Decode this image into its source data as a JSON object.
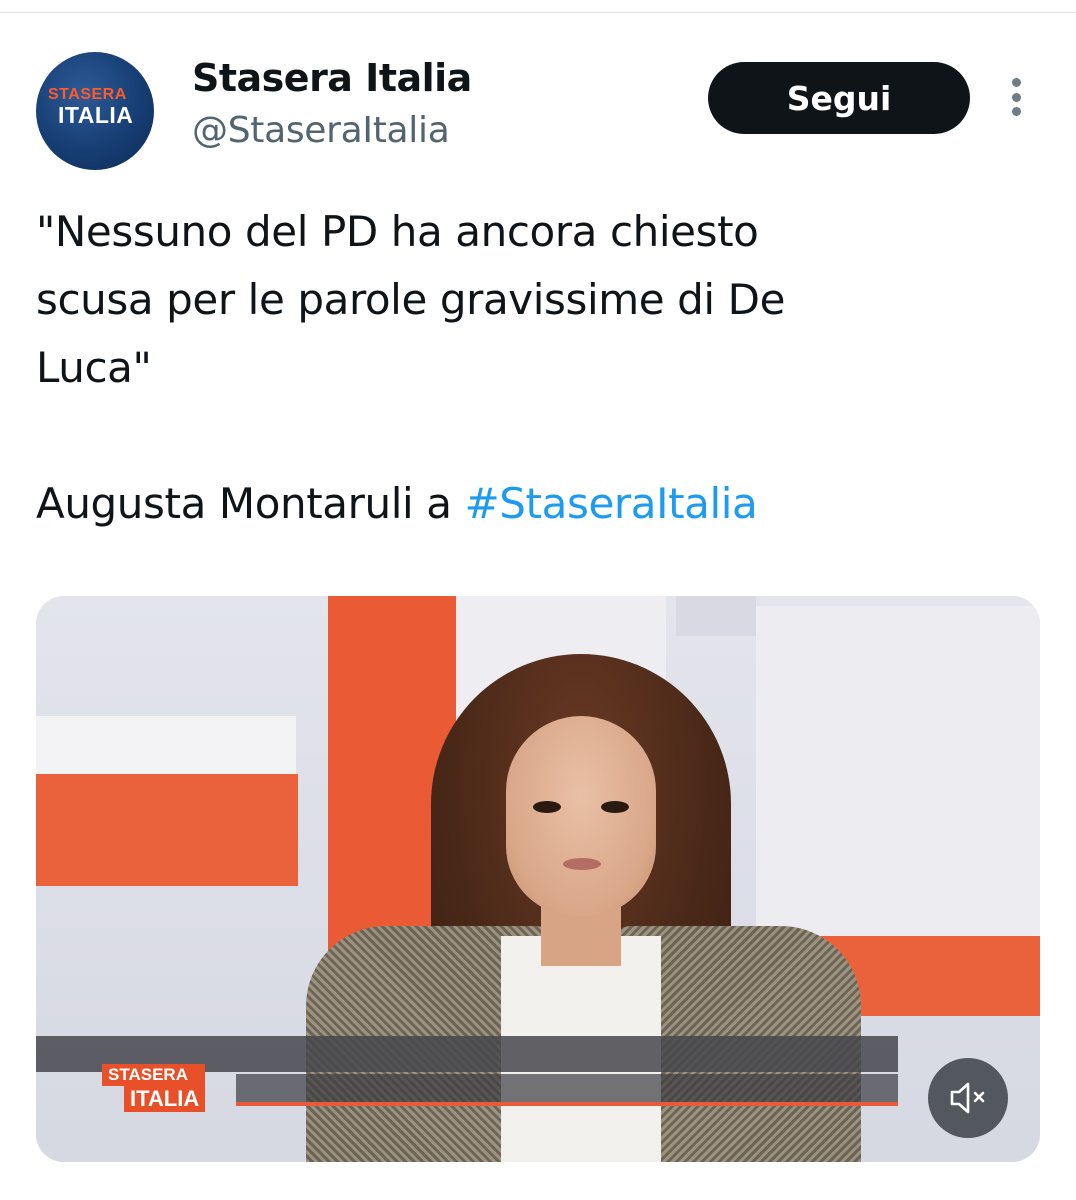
{
  "account": {
    "avatar_logo_top": "STASERA",
    "avatar_logo_bottom": "ITALIA",
    "display_name": "Stasera Italia",
    "handle": "@StaseraItalia",
    "follow_label": "Segui"
  },
  "tweet": {
    "lines": [
      "\"Nessuno del PD ha ancora chiesto",
      "scusa per le parole gravissime di De",
      "Luca\""
    ],
    "credit_prefix": "Augusta Montaruli a ",
    "hashtag": "#StaseraItalia"
  },
  "media": {
    "overlay_logo_top": "STASERA",
    "overlay_logo_bottom": "ITALIA",
    "mute_icon": "speaker-muted-icon"
  },
  "colors": {
    "follow_button_bg": "#0f1419",
    "hashtag": "#1d9bf0",
    "handle": "#536471",
    "brand_orange": "#e8502a"
  }
}
